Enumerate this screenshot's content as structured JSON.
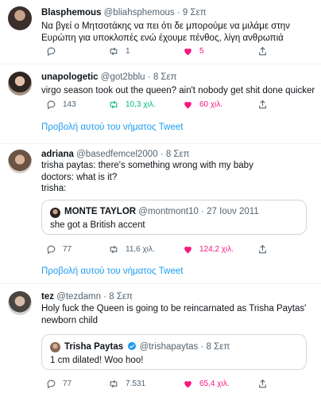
{
  "tweets": [
    {
      "name": "Blasphemous",
      "handle": "@bliahsphemous",
      "dot": "·",
      "date": "9 Σεπ",
      "text": "Να βγεί ο Μητσοτάκης να πει ότι δε μπορούμε να μιλάμε στην Ευρώπη για υποκλοπές ενώ έχουμε πένθος, λίγη ανθρωπιά",
      "replies": "",
      "retweets": "1",
      "likes": "5"
    },
    {
      "name": "unapologetic",
      "handle": "@got2bblu",
      "dot": "·",
      "date": "8 Σεπ",
      "text": "virgo season took out the queen? ain't nobody get shit done quicker",
      "replies": "143",
      "retweets": "10,3 χιλ.",
      "likes": "60 χιλ.",
      "thread_link": "Προβολή αυτού του νήματος Tweet"
    },
    {
      "name": "adriana",
      "handle": "@basedfemcel2000",
      "dot": "·",
      "date": "8 Σεπ",
      "text_lines": [
        "trisha paytas: there's something wrong with my baby",
        "doctors: what is it?",
        "trisha:"
      ],
      "quote": {
        "name": "MONTE TAYLOR",
        "handle": "@montmont10",
        "dot": "·",
        "date": "27 Ιουν 2011",
        "text": "she got a British accent"
      },
      "replies": "77",
      "retweets": "11,6 χιλ.",
      "likes": "124,2 χιλ.",
      "thread_link": "Προβολή αυτού του νήματος Tweet"
    },
    {
      "name": "tez",
      "handle": "@tezdamn",
      "dot": "·",
      "date": "8 Σεπ",
      "text": "Holy fuck the Queen is going to be reincarnated as Trisha Paytas' newborn child",
      "quote": {
        "name": "Trisha Paytas",
        "handle": "@trishapaytas",
        "dot": "·",
        "date": "8 Σεπ",
        "text": "1 cm dilated! Woo hoo!"
      },
      "replies": "77",
      "retweets": "7.531",
      "likes": "65,4 χιλ."
    }
  ],
  "colors": {
    "retweet_active": "#00ba7c",
    "like_active": "#f91880",
    "link": "#1d9bf0",
    "muted": "#536471"
  },
  "icons": [
    "reply-icon",
    "retweet-icon",
    "like-icon",
    "share-icon",
    "verified-badge-icon"
  ]
}
